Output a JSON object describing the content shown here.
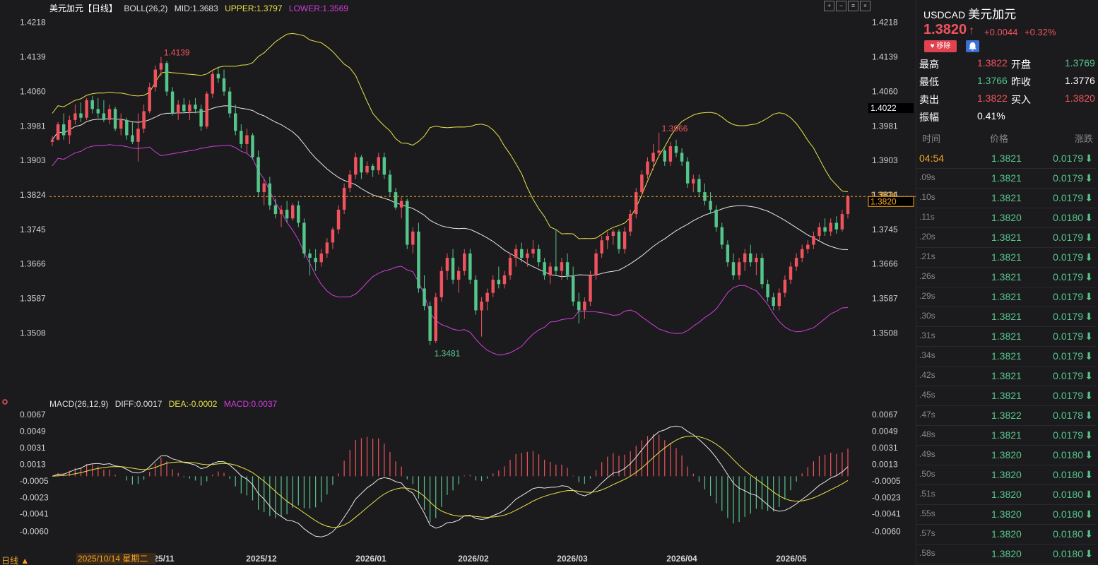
{
  "legend": {
    "name": "美元加元【日线】",
    "boll_label": "BOLL(26,2)",
    "mid": "MID:1.3683",
    "upper": "UPPER:1.3797",
    "lower": "LOWER:1.3569",
    "macd_label": "MACD(26,12,9)",
    "diff": "DIFF:0.0017",
    "dea": "DEA:-0.0002",
    "macd": "MACD:0.0037"
  },
  "colors": {
    "up": "#f0535d",
    "down": "#55c58a",
    "upper": "#e8e24a",
    "mid": "#e8e8e8",
    "lower": "#d23ddc",
    "accent": "#f5a623"
  },
  "price_axis": {
    "ticks": [
      "1.4218",
      "1.4139",
      "1.4060",
      "1.3981",
      "1.3903",
      "1.3824",
      "1.3745",
      "1.3666",
      "1.3587",
      "1.3508"
    ],
    "tag_1": "1.4022",
    "tag_2": "1.3824",
    "tag_3": "1.3820"
  },
  "macd_axis": {
    "ticks": [
      "0.0067",
      "0.0049",
      "0.0031",
      "0.0013",
      "-0.0005",
      "-0.0023",
      "-0.0041",
      "-0.0060"
    ]
  },
  "annotations": {
    "high": "1.4139",
    "low": "1.3481",
    "peak": "1.3966"
  },
  "x_axis": {
    "cursor_date": "2025/10/14 星期二",
    "labels": [
      "25/11",
      "2025/12",
      "2026/01",
      "2026/02",
      "2026/03",
      "2026/04",
      "2026/05"
    ],
    "period": "日线 ▲"
  },
  "toolbar": {
    "icons": [
      "zoom-in-icon",
      "zoom-out-icon",
      "settings-icon",
      "close-icon"
    ]
  },
  "quote": {
    "symbol": "USDCAD",
    "name": "美元加元",
    "price": "1.3820",
    "arrow": "↑",
    "change": "+0.0044",
    "change_pct": "+0.32%",
    "remove_label": "移除",
    "stats": [
      {
        "l1": "最高",
        "v1": "1.3822",
        "c1": "red",
        "l2": "开盘",
        "v2": "1.3769",
        "c2": "green"
      },
      {
        "l1": "最低",
        "v1": "1.3766",
        "c1": "green",
        "l2": "昨收",
        "v2": "1.3776",
        "c2": "white"
      },
      {
        "l1": "卖出",
        "v1": "1.3822",
        "c1": "red",
        "l2": "买入",
        "v2": "1.3820",
        "c2": "red"
      },
      {
        "l1": "振幅",
        "v1": "0.41%",
        "c1": "white",
        "l2": "",
        "v2": "",
        "c2": "white"
      }
    ]
  },
  "ticks": {
    "headers": [
      "时间",
      "价格",
      "涨跌"
    ],
    "rows": [
      {
        "t": "04:54",
        "p": "1.3821",
        "c": "0.0179"
      },
      {
        "t": ".09s",
        "p": "1.3821",
        "c": "0.0179"
      },
      {
        "t": ".10s",
        "p": "1.3821",
        "c": "0.0179"
      },
      {
        "t": ".11s",
        "p": "1.3820",
        "c": "0.0180"
      },
      {
        "t": ".20s",
        "p": "1.3821",
        "c": "0.0179"
      },
      {
        "t": ".21s",
        "p": "1.3821",
        "c": "0.0179"
      },
      {
        "t": ".26s",
        "p": "1.3821",
        "c": "0.0179"
      },
      {
        "t": ".29s",
        "p": "1.3821",
        "c": "0.0179"
      },
      {
        "t": ".30s",
        "p": "1.3821",
        "c": "0.0179"
      },
      {
        "t": ".31s",
        "p": "1.3821",
        "c": "0.0179"
      },
      {
        "t": ".34s",
        "p": "1.3821",
        "c": "0.0179"
      },
      {
        "t": ".42s",
        "p": "1.3821",
        "c": "0.0179"
      },
      {
        "t": ".45s",
        "p": "1.3821",
        "c": "0.0179"
      },
      {
        "t": ".47s",
        "p": "1.3822",
        "c": "0.0178"
      },
      {
        "t": ".48s",
        "p": "1.3821",
        "c": "0.0179"
      },
      {
        "t": ".49s",
        "p": "1.3820",
        "c": "0.0180"
      },
      {
        "t": ".50s",
        "p": "1.3820",
        "c": "0.0180"
      },
      {
        "t": ".51s",
        "p": "1.3820",
        "c": "0.0180"
      },
      {
        "t": ".55s",
        "p": "1.3820",
        "c": "0.0180"
      },
      {
        "t": ".57s",
        "p": "1.3820",
        "c": "0.0180"
      },
      {
        "t": ".58s",
        "p": "1.3820",
        "c": "0.0180"
      }
    ]
  },
  "chart_data": {
    "type": "candlestick",
    "price_range": [
      1.343,
      1.424
    ],
    "macd_range": [
      -0.0075,
      0.0074
    ],
    "candles": [
      [
        1.3945,
        1.3958,
        1.3935,
        1.395
      ],
      [
        1.395,
        1.399,
        1.3948,
        1.3985
      ],
      [
        1.3985,
        1.401,
        1.395,
        1.396
      ],
      [
        1.396,
        1.4005,
        1.394,
        1.3995
      ],
      [
        1.3995,
        1.403,
        1.3985,
        1.401
      ],
      [
        1.401,
        1.4035,
        1.399,
        1.4
      ],
      [
        1.4,
        1.4045,
        1.3995,
        1.404
      ],
      [
        1.404,
        1.405,
        1.401,
        1.402
      ],
      [
        1.402,
        1.4045,
        1.4,
        1.401
      ],
      [
        1.401,
        1.404,
        1.399,
        1.3995
      ],
      [
        1.3995,
        1.403,
        1.3985,
        1.402
      ],
      [
        1.402,
        1.4025,
        1.397,
        1.3975
      ],
      [
        1.3975,
        1.401,
        1.396,
        1.3995
      ],
      [
        1.3995,
        1.4,
        1.395,
        1.396
      ],
      [
        1.396,
        1.399,
        1.394,
        1.3945
      ],
      [
        1.3945,
        1.401,
        1.39,
        1.3975
      ],
      [
        1.3975,
        1.403,
        1.3965,
        1.4015
      ],
      [
        1.4015,
        1.408,
        1.401,
        1.407
      ],
      [
        1.407,
        1.412,
        1.406,
        1.411
      ],
      [
        1.411,
        1.4139,
        1.4095,
        1.4125
      ],
      [
        1.4125,
        1.413,
        1.405,
        1.406
      ],
      [
        1.406,
        1.407,
        1.4005,
        1.401
      ],
      [
        1.401,
        1.404,
        1.3995,
        1.403
      ],
      [
        1.403,
        1.4045,
        1.401,
        1.4015
      ],
      [
        1.4015,
        1.404,
        1.3995,
        1.403
      ],
      [
        1.403,
        1.4045,
        1.401,
        1.402
      ],
      [
        1.402,
        1.403,
        1.397,
        1.398
      ],
      [
        1.398,
        1.406,
        1.3975,
        1.4055
      ],
      [
        1.4055,
        1.411,
        1.4045,
        1.41
      ],
      [
        1.41,
        1.4115,
        1.408,
        1.409
      ],
      [
        1.409,
        1.411,
        1.405,
        1.406
      ],
      [
        1.406,
        1.407,
        1.4,
        1.401
      ],
      [
        1.401,
        1.403,
        1.396,
        1.397
      ],
      [
        1.397,
        1.3985,
        1.393,
        1.394
      ],
      [
        1.394,
        1.3975,
        1.392,
        1.396
      ],
      [
        1.396,
        1.3965,
        1.3905,
        1.391
      ],
      [
        1.391,
        1.3925,
        1.382,
        1.383
      ],
      [
        1.383,
        1.386,
        1.38,
        1.385
      ],
      [
        1.385,
        1.3865,
        1.379,
        1.38
      ],
      [
        1.38,
        1.3815,
        1.377,
        1.378
      ],
      [
        1.378,
        1.38,
        1.375,
        1.379
      ],
      [
        1.379,
        1.381,
        1.376,
        1.377
      ],
      [
        1.377,
        1.3805,
        1.3765,
        1.38
      ],
      [
        1.38,
        1.381,
        1.375,
        1.376
      ],
      [
        1.376,
        1.377,
        1.368,
        1.369
      ],
      [
        1.369,
        1.37,
        1.364,
        1.368
      ],
      [
        1.368,
        1.37,
        1.365,
        1.367
      ],
      [
        1.367,
        1.37,
        1.366,
        1.369
      ],
      [
        1.369,
        1.3725,
        1.368,
        1.3715
      ],
      [
        1.3715,
        1.375,
        1.37,
        1.3745
      ],
      [
        1.3745,
        1.38,
        1.3735,
        1.379
      ],
      [
        1.379,
        1.385,
        1.378,
        1.384
      ],
      [
        1.384,
        1.388,
        1.383,
        1.387
      ],
      [
        1.387,
        1.392,
        1.386,
        1.391
      ],
      [
        1.391,
        1.3915,
        1.386,
        1.3875
      ],
      [
        1.3875,
        1.39,
        1.387,
        1.389
      ],
      [
        1.389,
        1.3895,
        1.3865,
        1.388
      ],
      [
        1.388,
        1.392,
        1.387,
        1.391
      ],
      [
        1.391,
        1.392,
        1.386,
        1.387
      ],
      [
        1.387,
        1.388,
        1.382,
        1.383
      ],
      [
        1.383,
        1.384,
        1.379,
        1.3795
      ],
      [
        1.3795,
        1.382,
        1.377,
        1.381
      ],
      [
        1.381,
        1.3815,
        1.37,
        1.371
      ],
      [
        1.371,
        1.375,
        1.369,
        1.374
      ],
      [
        1.374,
        1.376,
        1.36,
        1.361
      ],
      [
        1.361,
        1.364,
        1.356,
        1.357
      ],
      [
        1.357,
        1.358,
        1.3481,
        1.349
      ],
      [
        1.349,
        1.36,
        1.3485,
        1.359
      ],
      [
        1.359,
        1.366,
        1.358,
        1.365
      ],
      [
        1.365,
        1.369,
        1.363,
        1.368
      ],
      [
        1.368,
        1.37,
        1.362,
        1.363
      ],
      [
        1.363,
        1.366,
        1.36,
        1.365
      ],
      [
        1.365,
        1.37,
        1.364,
        1.369
      ],
      [
        1.369,
        1.37,
        1.362,
        1.363
      ],
      [
        1.363,
        1.364,
        1.355,
        1.356
      ],
      [
        1.356,
        1.359,
        1.35,
        1.358
      ],
      [
        1.358,
        1.361,
        1.356,
        1.36
      ],
      [
        1.36,
        1.364,
        1.359,
        1.363
      ],
      [
        1.363,
        1.366,
        1.361,
        1.362
      ],
      [
        1.362,
        1.365,
        1.361,
        1.364
      ],
      [
        1.364,
        1.369,
        1.363,
        1.368
      ],
      [
        1.368,
        1.371,
        1.366,
        1.37
      ],
      [
        1.37,
        1.3715,
        1.367,
        1.368
      ],
      [
        1.368,
        1.37,
        1.366,
        1.369
      ],
      [
        1.369,
        1.372,
        1.368,
        1.37
      ],
      [
        1.37,
        1.371,
        1.366,
        1.367
      ],
      [
        1.367,
        1.368,
        1.363,
        1.364
      ],
      [
        1.364,
        1.367,
        1.362,
        1.366
      ],
      [
        1.366,
        1.3745,
        1.364,
        1.365
      ],
      [
        1.365,
        1.368,
        1.363,
        1.367
      ],
      [
        1.367,
        1.369,
        1.363,
        1.364
      ],
      [
        1.364,
        1.366,
        1.357,
        1.358
      ],
      [
        1.358,
        1.36,
        1.353,
        1.356
      ],
      [
        1.356,
        1.359,
        1.354,
        1.358
      ],
      [
        1.358,
        1.365,
        1.357,
        1.364
      ],
      [
        1.364,
        1.37,
        1.363,
        1.369
      ],
      [
        1.369,
        1.373,
        1.368,
        1.372
      ],
      [
        1.372,
        1.374,
        1.37,
        1.373
      ],
      [
        1.373,
        1.3745,
        1.371,
        1.374
      ],
      [
        1.374,
        1.3745,
        1.369,
        1.37
      ],
      [
        1.37,
        1.375,
        1.369,
        1.374
      ],
      [
        1.374,
        1.379,
        1.373,
        1.378
      ],
      [
        1.378,
        1.384,
        1.377,
        1.383
      ],
      [
        1.383,
        1.388,
        1.382,
        1.387
      ],
      [
        1.387,
        1.391,
        1.386,
        1.39
      ],
      [
        1.39,
        1.394,
        1.388,
        1.392
      ],
      [
        1.392,
        1.3966,
        1.391,
        1.3925
      ],
      [
        1.3925,
        1.393,
        1.389,
        1.39
      ],
      [
        1.39,
        1.3945,
        1.389,
        1.3935
      ],
      [
        1.3935,
        1.395,
        1.391,
        1.392
      ],
      [
        1.392,
        1.393,
        1.389,
        1.39
      ],
      [
        1.39,
        1.391,
        1.384,
        1.385
      ],
      [
        1.385,
        1.387,
        1.383,
        1.386
      ],
      [
        1.386,
        1.387,
        1.382,
        1.383
      ],
      [
        1.383,
        1.385,
        1.38,
        1.381
      ],
      [
        1.381,
        1.383,
        1.378,
        1.379
      ],
      [
        1.379,
        1.38,
        1.374,
        1.375
      ],
      [
        1.375,
        1.376,
        1.37,
        1.371
      ],
      [
        1.371,
        1.372,
        1.366,
        1.367
      ],
      [
        1.367,
        1.369,
        1.363,
        1.364
      ],
      [
        1.364,
        1.368,
        1.363,
        1.367
      ],
      [
        1.367,
        1.37,
        1.365,
        1.369
      ],
      [
        1.369,
        1.371,
        1.366,
        1.367
      ],
      [
        1.367,
        1.369,
        1.364,
        1.368
      ],
      [
        1.368,
        1.369,
        1.361,
        1.362
      ],
      [
        1.362,
        1.363,
        1.358,
        1.359
      ],
      [
        1.359,
        1.36,
        1.356,
        1.357
      ],
      [
        1.357,
        1.361,
        1.356,
        1.36
      ],
      [
        1.36,
        1.364,
        1.359,
        1.363
      ],
      [
        1.363,
        1.367,
        1.362,
        1.366
      ],
      [
        1.366,
        1.369,
        1.365,
        1.368
      ],
      [
        1.368,
        1.371,
        1.367,
        1.37
      ],
      [
        1.37,
        1.372,
        1.369,
        1.371
      ],
      [
        1.371,
        1.374,
        1.37,
        1.373
      ],
      [
        1.373,
        1.376,
        1.372,
        1.375
      ],
      [
        1.375,
        1.377,
        1.373,
        1.374
      ],
      [
        1.374,
        1.377,
        1.373,
        1.376
      ],
      [
        1.376,
        1.3775,
        1.3735,
        1.3745
      ],
      [
        1.3745,
        1.379,
        1.374,
        1.378
      ],
      [
        1.378,
        1.3824,
        1.377,
        1.382
      ]
    ]
  }
}
